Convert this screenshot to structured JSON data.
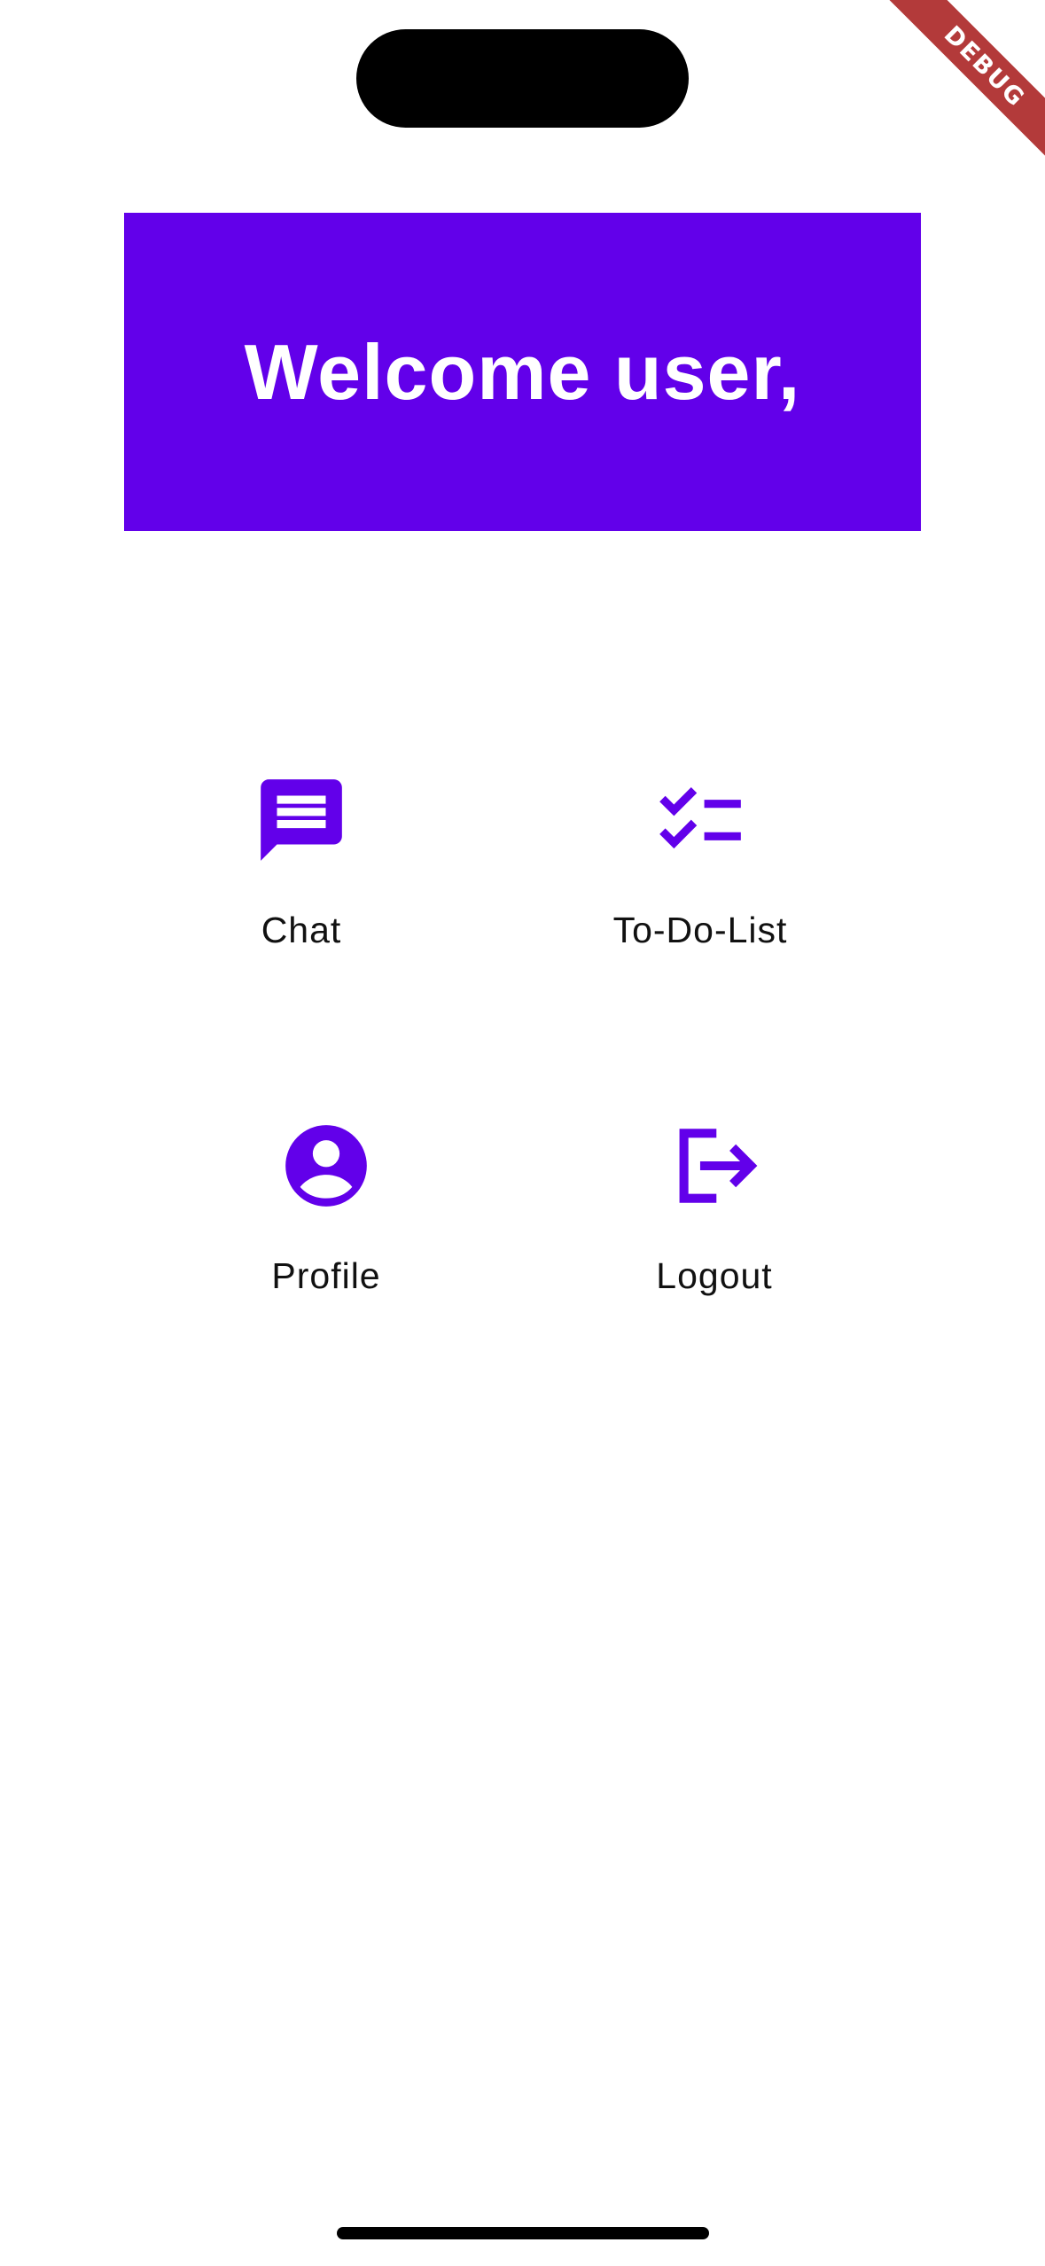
{
  "debug_banner": {
    "label": "DEBUG"
  },
  "header": {
    "title": "Welcome user,"
  },
  "menu": {
    "items": [
      {
        "label": "Chat",
        "icon": "chat-icon"
      },
      {
        "label": "To-Do-List",
        "icon": "checklist-icon"
      },
      {
        "label": "Profile",
        "icon": "account-circle-icon"
      },
      {
        "label": "Logout",
        "icon": "logout-icon"
      }
    ]
  },
  "colors": {
    "accent": "#6200ea",
    "debug_ribbon": "#b33a3a",
    "label_text": "#111111"
  }
}
